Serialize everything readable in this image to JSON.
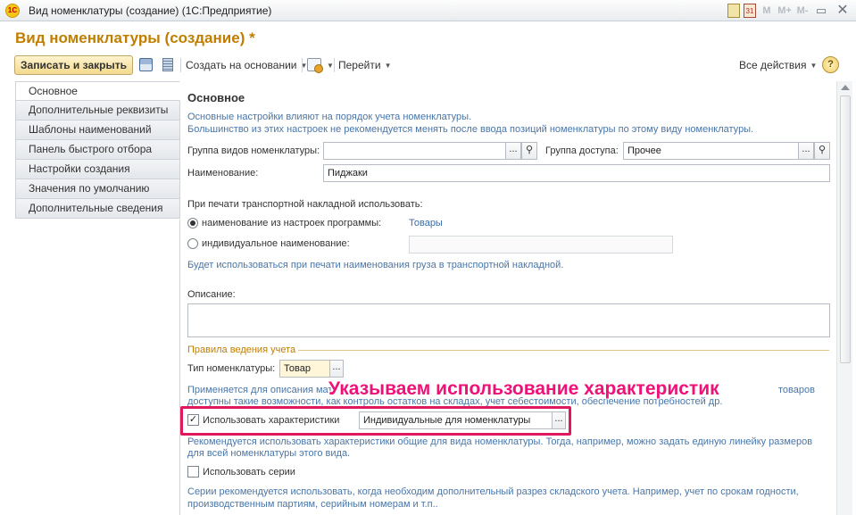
{
  "window": {
    "title": "Вид номенклатуры (создание)  (1С:Предприятие)",
    "logo_text": "1С",
    "calendar_day": "31",
    "memory_buttons": [
      "M",
      "M+",
      "M-"
    ],
    "window_button": "▭",
    "close_button": "✕"
  },
  "form": {
    "title": "Вид номенклатуры (создание) *"
  },
  "toolbar": {
    "save_close_label": "Записать и закрыть",
    "create_based_label": "Создать на основании",
    "goto_label": "Перейти",
    "all_actions_label": "Все действия",
    "help_label": "?"
  },
  "nav": {
    "items": [
      {
        "label": "Основное",
        "active": true
      },
      {
        "label": "Дополнительные реквизиты"
      },
      {
        "label": "Шаблоны наименований"
      },
      {
        "label": "Панель быстрого отбора"
      },
      {
        "label": "Настройки создания"
      },
      {
        "label": "Значения по умолчанию"
      },
      {
        "label": "Дополнительные сведения"
      }
    ]
  },
  "main": {
    "section_title": "Основное",
    "hint_line1": "Основные настройки влияют на порядок учета номенклатуры.",
    "hint_line2": "Большинство из этих настроек не рекомендуется менять после ввода позиций номенклатуры по этому виду номенклатуры.",
    "group_label": "Группа видов номенклатуры:",
    "group_value": "",
    "access_label": "Группа доступа:",
    "access_value": "Прочее",
    "name_label": "Наименование:",
    "name_value": "Пиджаки",
    "print_label": "При печати транспортной накладной использовать:",
    "radio1_label": "наименование из настроек программы:",
    "radio1_link": "Товары",
    "radio2_label": "индивидуальное наименование:",
    "radio2_value": "",
    "print_hint": "Будет использоваться при печати наименования груза в транспортной накладной.",
    "description_label": "Описание:",
    "description_value": "",
    "accounting_group": "Правила ведения учета",
    "type_label": "Тип номенклатуры:",
    "type_value": "Товар",
    "type_hint1_start": "Применяется для описания мат",
    "type_hint1_end": "товаров",
    "type_hint2": "доступны такие возможности, как контроль остатков на складах, учет себестоимости, обеспечение потребностей др.",
    "use_characteristics_label": "Использовать характеристики",
    "use_characteristics_checked": true,
    "characteristics_value": "Индивидуальные для номенклатуры",
    "char_hint1": "Рекомендуется использовать характеристики общие для вида номенклатуры. Тогда, например, можно задать единую линейку размеров",
    "char_hint2": "для всей номенклатуры этого вида.",
    "use_series_label": "Использовать серии",
    "use_series_checked": false,
    "series_hint1": "Серии рекомендуется использовать, когда необходим дополнительный разрез складского учета. Например, учет по срокам годности,",
    "series_hint2": "производственным партиям, серийным номерам и т.п..",
    "select_button": "...",
    "search_icon_glyph": "🔍"
  },
  "annotation": {
    "text": "Указываем использование характеристик",
    "color": "#ee1177"
  }
}
